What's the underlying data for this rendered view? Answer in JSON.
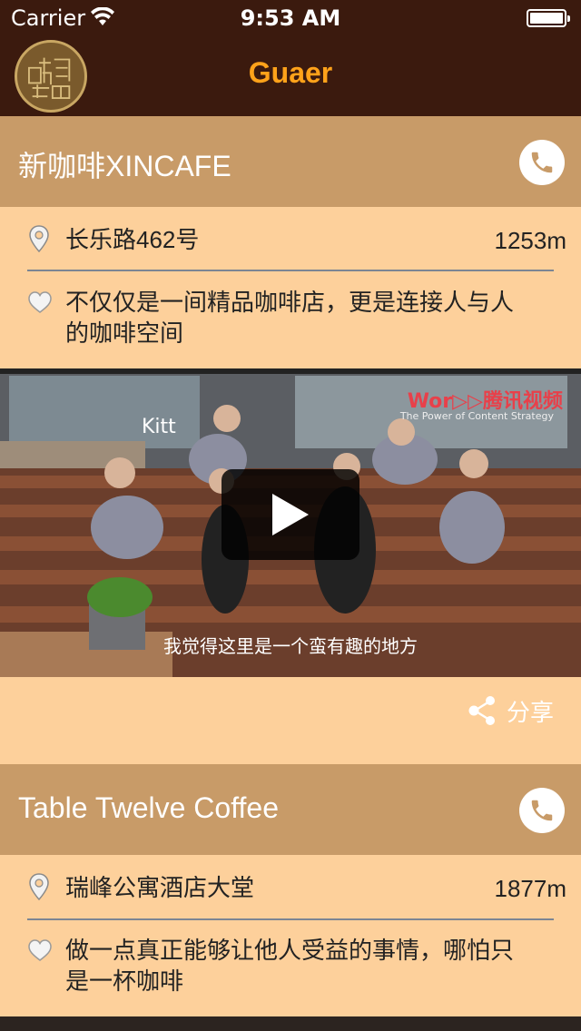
{
  "status_bar": {
    "carrier": "Carrier",
    "time": "9:53 AM"
  },
  "nav": {
    "title": "Guaer",
    "logo_icon": "guaer-logo"
  },
  "colors": {
    "nav_bg": "#3b1a0e",
    "title": "#ffa21a",
    "header_bar": "#c89b68",
    "card_bg": "#fdd09b"
  },
  "shops": [
    {
      "name": "新咖啡XINCAFE",
      "address": "长乐路462号",
      "distance": "1253m",
      "description_line1": "不仅仅是一间精品咖啡店，更是连接人与人",
      "description_line2": "的咖啡空间",
      "video": {
        "subtitle": "我觉得这里是一个蛮有趣的地方",
        "watermark": "Wor▷▷腾讯视频",
        "watermark_sub": "The Power of Content Strategy",
        "sign": "Kitt"
      },
      "share_label": "分享"
    },
    {
      "name": "Table Twelve Coffee",
      "address": "瑞峰公寓酒店大堂",
      "distance": "1877m",
      "description_line1": "做一点真正能够让他人受益的事情，哪怕只",
      "description_line2": "是一杯咖啡"
    }
  ]
}
